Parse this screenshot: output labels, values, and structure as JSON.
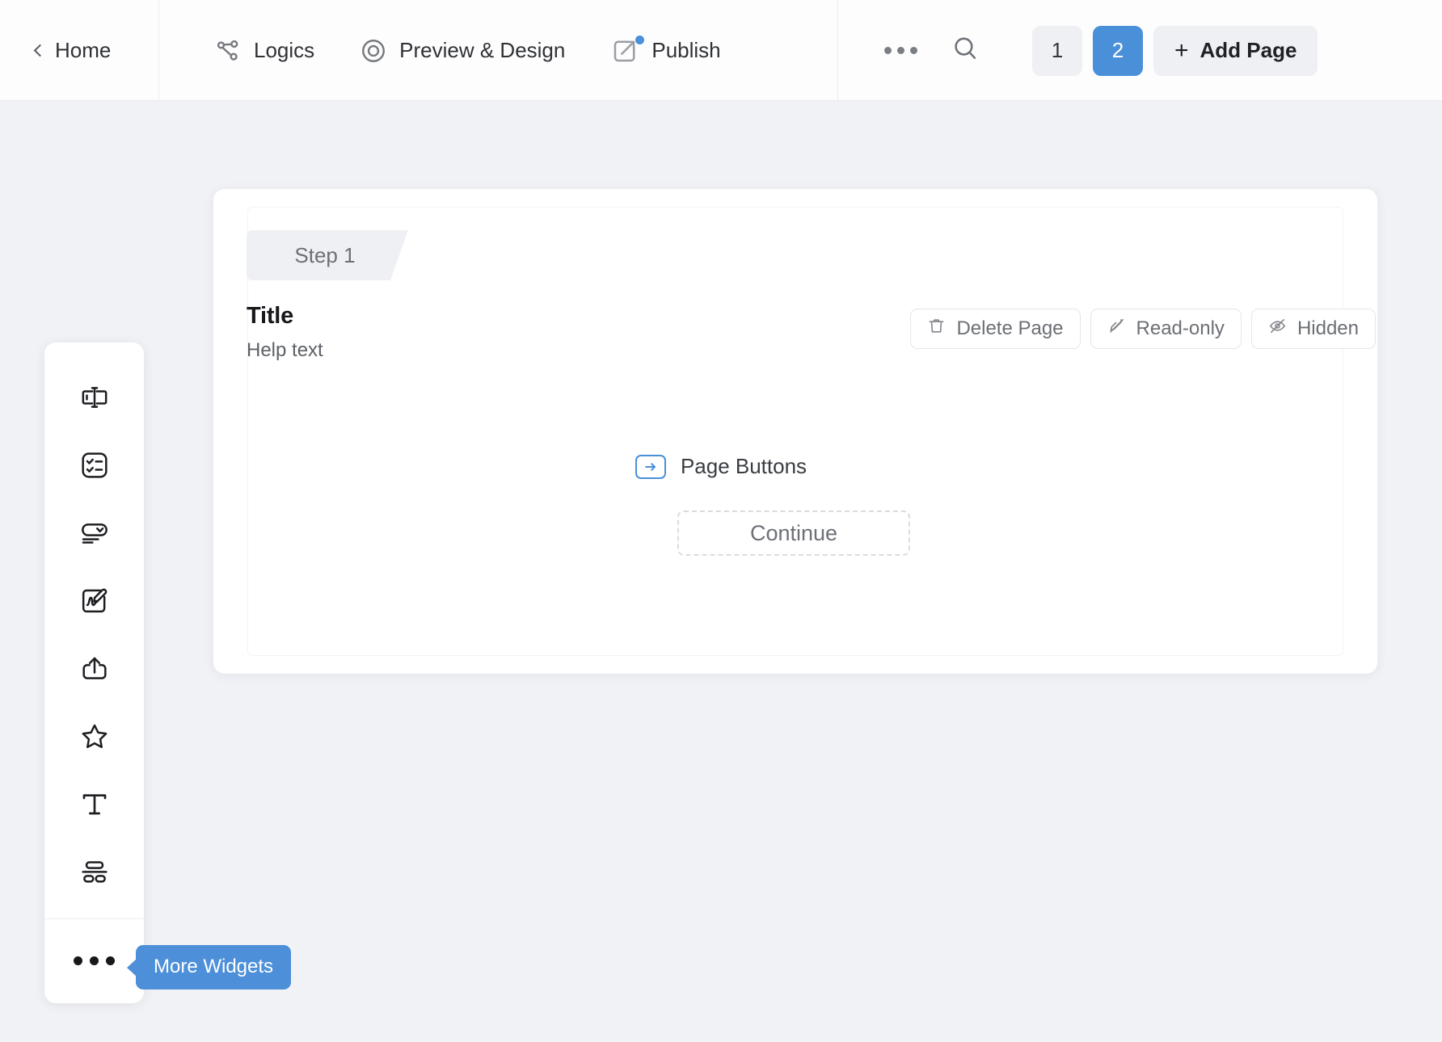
{
  "header": {
    "home": {
      "label": "Home",
      "icon": "chevron-left-icon"
    },
    "nav": [
      {
        "label": "Logics",
        "icon": "logics-branch-icon"
      },
      {
        "label": "Preview & Design",
        "icon": "eye-target-icon"
      },
      {
        "label": "Publish",
        "icon": "external-link-icon",
        "badge_dot": true
      }
    ],
    "more_icon": "more-horizontal-icon",
    "search_icon": "search-icon",
    "pages": [
      {
        "label": "1",
        "active": false
      },
      {
        "label": "2",
        "active": true
      }
    ],
    "add_page": {
      "label": "Add Page",
      "plus": "+"
    }
  },
  "sidebar": {
    "widgets": [
      {
        "name": "text-input-icon"
      },
      {
        "name": "checklist-icon"
      },
      {
        "name": "dropdown-icon"
      },
      {
        "name": "signature-icon"
      },
      {
        "name": "upload-icon"
      },
      {
        "name": "star-rating-icon"
      },
      {
        "name": "text-block-icon"
      },
      {
        "name": "layout-icon"
      }
    ],
    "more_icon": "more-horizontal-icon",
    "tooltip": "More Widgets"
  },
  "card": {
    "step_badge": "Step 1",
    "title": "Title",
    "help_text": "Help text",
    "actions": [
      {
        "label": "Delete Page",
        "icon": "trash-icon"
      },
      {
        "label": "Read-only",
        "icon": "pen-off-icon"
      },
      {
        "label": "Hidden",
        "icon": "eye-off-icon"
      }
    ],
    "page_buttons_label": "Page Buttons",
    "page_buttons_icon": "arrow-right-box-icon",
    "continue_label": "Continue"
  },
  "colors": {
    "accent": "#4a90d9",
    "background": "#f1f2f6",
    "surface": "#ffffff",
    "chip": "#eff0f3",
    "text": "#17181c",
    "muted": "#6d7076"
  }
}
